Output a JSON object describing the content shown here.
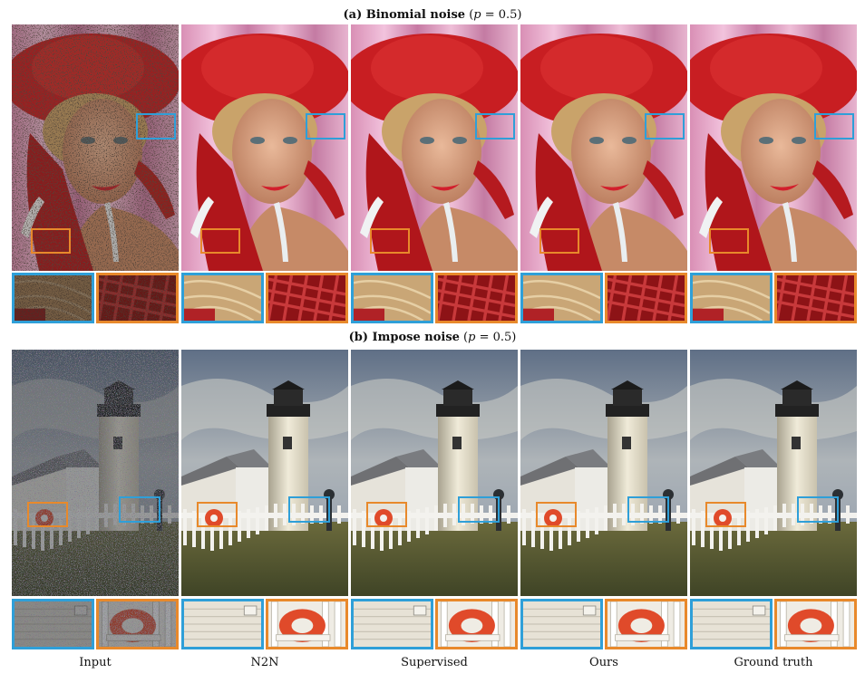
{
  "figure": {
    "row_a": {
      "title_bold": "(a) Binomial noise",
      "title_open": "(",
      "title_var": "p",
      "title_eq": " = 0.5)"
    },
    "row_b": {
      "title_bold": "(b) Impose noise",
      "title_open": "(",
      "title_var": "p",
      "title_eq": " = 0.5)"
    },
    "columns": [
      "Input",
      "N2N",
      "Supervised",
      "Ours",
      "Ground truth"
    ]
  }
}
